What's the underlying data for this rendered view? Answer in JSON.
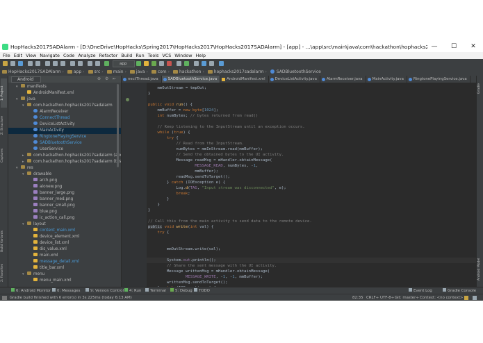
{
  "window": {
    "title": "HopHacks2017SADAlarm - [D:\\OneDrive\\HopHacks\\Spring2017\\HopHacks2017\\HopHacks2017SADAlarm] - [app] - ...\\app\\src\\main\\java\\com\\hackathon\\hophacks2017sadalarm\\SADBluetoothService.java - Android Studio 2.2.3",
    "minimize": "—",
    "maximize": "☐",
    "close": "✕"
  },
  "menu": [
    "File",
    "Edit",
    "View",
    "Navigate",
    "Code",
    "Analyze",
    "Refactor",
    "Build",
    "Run",
    "Tools",
    "VCS",
    "Window",
    "Help"
  ],
  "toolbar": {
    "run_config": "app"
  },
  "breadcrumbs": [
    "HopHacks2017SADAlarm",
    "app",
    "src",
    "main",
    "java",
    "com",
    "hackathon",
    "hophacks2017sadalarm",
    "SADBluetoothService"
  ],
  "left_tool_tabs": [
    "1: Project",
    "Z: Structure",
    "Captures",
    "Build Variants",
    "2: Favorites"
  ],
  "right_tool_tabs": [
    "Gradle",
    "Android Model"
  ],
  "project_view": {
    "mode": "Android"
  },
  "tree": [
    {
      "label": "manifests",
      "depth": 0,
      "icon": "folder",
      "arrow": "▾"
    },
    {
      "label": "AndroidManifest.xml",
      "depth": 1,
      "icon": "xml"
    },
    {
      "label": "java",
      "depth": 0,
      "icon": "folder",
      "arrow": "▾"
    },
    {
      "label": "com.hackathon.hophacks2017sadalarm",
      "depth": 1,
      "icon": "package",
      "arrow": "▾"
    },
    {
      "label": "AlarmReceiver",
      "depth": 2,
      "icon": "class"
    },
    {
      "label": "ConnectThread",
      "depth": 2,
      "icon": "class",
      "color": "#4a9bd8"
    },
    {
      "label": "DeviceListActivity",
      "depth": 2,
      "icon": "class"
    },
    {
      "label": "MainActivity",
      "depth": 2,
      "icon": "class",
      "selected": true
    },
    {
      "label": "RingtonePlayingService",
      "depth": 2,
      "icon": "class",
      "color": "#4a9bd8"
    },
    {
      "label": "SADBluetoothService",
      "depth": 2,
      "icon": "class",
      "color": "#4a9bd8"
    },
    {
      "label": "UserService",
      "depth": 2,
      "icon": "class"
    },
    {
      "label": "com.hackathon.hophacks2017sadalarm (androidTest)",
      "depth": 1,
      "icon": "package",
      "arrow": "▸"
    },
    {
      "label": "com.hackathon.hophacks2017sadalarm (test)",
      "depth": 1,
      "icon": "package",
      "arrow": "▸"
    },
    {
      "label": "res",
      "depth": 0,
      "icon": "folder",
      "arrow": "▾"
    },
    {
      "label": "drawable",
      "depth": 1,
      "icon": "folder",
      "arrow": "▾"
    },
    {
      "label": "arch.png",
      "depth": 2,
      "icon": "image"
    },
    {
      "label": "aionew.png",
      "depth": 2,
      "icon": "image"
    },
    {
      "label": "banner_large.png",
      "depth": 2,
      "icon": "image"
    },
    {
      "label": "banner_med.png",
      "depth": 2,
      "icon": "image"
    },
    {
      "label": "banner_small.png",
      "depth": 2,
      "icon": "image"
    },
    {
      "label": "blue.png",
      "depth": 2,
      "icon": "image"
    },
    {
      "label": "ic_action_call.png",
      "depth": 2,
      "icon": "image"
    },
    {
      "label": "layout",
      "depth": 1,
      "icon": "folder",
      "arrow": "▾"
    },
    {
      "label": "content_main.xml",
      "depth": 2,
      "icon": "xml",
      "color": "#4a9bd8"
    },
    {
      "label": "device_element.xml",
      "depth": 2,
      "icon": "xml"
    },
    {
      "label": "device_list.xml",
      "depth": 2,
      "icon": "xml"
    },
    {
      "label": "dis_value.xml",
      "depth": 2,
      "icon": "xml"
    },
    {
      "label": "main.xml",
      "depth": 2,
      "icon": "xml"
    },
    {
      "label": "message_detail.xml",
      "depth": 2,
      "icon": "xml",
      "color": "#4a9bd8"
    },
    {
      "label": "title_bar.xml",
      "depth": 2,
      "icon": "xml"
    },
    {
      "label": "menu",
      "depth": 1,
      "icon": "folder",
      "arrow": "▾"
    },
    {
      "label": "menu_main.xml",
      "depth": 2,
      "icon": "xml"
    }
  ],
  "editor_tabs": [
    {
      "label": "nectThread.java",
      "type": "java"
    },
    {
      "label": "SADBluetoothService.java",
      "type": "java",
      "active": true
    },
    {
      "label": "AndroidManifest.xml",
      "type": "xml"
    },
    {
      "label": "DeviceListActivity.java",
      "type": "java"
    },
    {
      "label": "AlarmReceiver.java",
      "type": "java"
    },
    {
      "label": "MainActivity.java",
      "type": "java"
    },
    {
      "label": "RingtonePlayingService.java",
      "type": "java"
    }
  ],
  "code_lines": [
    {
      "i": 0,
      "parts": [
        [
          "",
          "    mmOutStream = tmpOut;"
        ]
      ]
    },
    {
      "i": 1,
      "parts": [
        [
          "",
          "}"
        ]
      ]
    },
    {
      "i": 3,
      "parts": [
        [
          "kw",
          "public void "
        ],
        [
          "fn",
          "run"
        ],
        [
          "",
          "() {"
        ]
      ]
    },
    {
      "i": 4,
      "parts": [
        [
          "",
          "    mmBuffer = "
        ],
        [
          "kw",
          "new byte"
        ],
        [
          "",
          "["
        ],
        [
          "nm",
          "1024"
        ],
        [
          "",
          "];"
        ]
      ]
    },
    {
      "i": 5,
      "parts": [
        [
          "kw",
          "    int "
        ],
        [
          "",
          "numBytes; "
        ],
        [
          "cm",
          "// bytes returned from read()"
        ]
      ]
    },
    {
      "i": 7,
      "parts": [
        [
          "cm",
          "    // Keep listening to the InputStream until an exception occurs."
        ]
      ]
    },
    {
      "i": 8,
      "parts": [
        [
          "kw",
          "    while "
        ],
        [
          "",
          "("
        ],
        [
          "kw",
          "true"
        ],
        [
          "",
          ") {"
        ]
      ]
    },
    {
      "i": 9,
      "parts": [
        [
          "kw",
          "        try "
        ],
        [
          "",
          "{"
        ]
      ]
    },
    {
      "i": 10,
      "parts": [
        [
          "cm",
          "            // Read from the InputStream."
        ]
      ]
    },
    {
      "i": 11,
      "parts": [
        [
          "",
          "            numBytes = mmInStream.read(mmBuffer);"
        ]
      ]
    },
    {
      "i": 12,
      "parts": [
        [
          "cm",
          "            // Send the obtained bytes to the UI activity."
        ]
      ]
    },
    {
      "i": 13,
      "parts": [
        [
          "",
          "            Message readMsg = mHandler.obtainMessage("
        ]
      ]
    },
    {
      "i": 14,
      "parts": [
        [
          "pu",
          "                    MESSAGE_READ"
        ],
        [
          "",
          ", numBytes, -"
        ],
        [
          "nm",
          "1"
        ],
        [
          "",
          ","
        ]
      ]
    },
    {
      "i": 15,
      "parts": [
        [
          "",
          "                    mmBuffer);"
        ]
      ]
    },
    {
      "i": 16,
      "parts": [
        [
          "",
          "            readMsg.sendToTarget();"
        ]
      ]
    },
    {
      "i": 17,
      "parts": [
        [
          "",
          "        } "
        ],
        [
          "kw",
          "catch "
        ],
        [
          "",
          "(IOException e) {"
        ]
      ]
    },
    {
      "i": 18,
      "parts": [
        [
          "",
          "            Log."
        ],
        [
          "fn",
          "d"
        ],
        [
          "",
          "("
        ],
        [
          "pu",
          "TAG"
        ],
        [
          "",
          ", "
        ],
        [
          "st",
          "\"Input stream was disconnected\""
        ],
        [
          "",
          ", e);"
        ]
      ]
    },
    {
      "i": 19,
      "parts": [
        [
          "kw",
          "            break"
        ],
        [
          "",
          ";"
        ]
      ]
    },
    {
      "i": 20,
      "parts": [
        [
          "",
          "        }"
        ]
      ]
    },
    {
      "i": 21,
      "parts": [
        [
          "",
          "    }"
        ]
      ]
    },
    {
      "i": 22,
      "parts": [
        [
          "",
          "}"
        ]
      ]
    },
    {
      "i": 24,
      "parts": [
        [
          "cm",
          "// Call this from the main activity to send data to the remote device."
        ]
      ]
    },
    {
      "i": 25,
      "parts": [
        [
          "hl",
          "public"
        ],
        [
          "kw",
          " void "
        ],
        [
          "fn",
          "write"
        ],
        [
          "",
          "("
        ],
        [
          "kw",
          "int "
        ],
        [
          "",
          "val) {"
        ]
      ]
    },
    {
      "i": 26,
      "parts": [
        [
          "kw",
          "    try "
        ],
        [
          "",
          "{"
        ]
      ]
    },
    {
      "i": 29,
      "parts": [
        [
          "",
          "        mmOutStream.write(val);"
        ]
      ]
    },
    {
      "i": 31,
      "parts": [
        [
          "",
          "        System."
        ],
        [
          "pu",
          "out"
        ],
        [
          "",
          ".println();"
        ]
      ]
    },
    {
      "i": 32,
      "parts": [
        [
          "cm",
          "        // Share the sent message with the UI activity."
        ]
      ]
    },
    {
      "i": 33,
      "parts": [
        [
          "",
          "        Message writtenMsg = mHandler.obtainMessage("
        ]
      ]
    },
    {
      "i": 34,
      "parts": [
        [
          "pu",
          "                MESSAGE_WRITE"
        ],
        [
          "",
          ", -"
        ],
        [
          "nm",
          "1"
        ],
        [
          "",
          ", -"
        ],
        [
          "nm",
          "1"
        ],
        [
          "",
          ", mmBuffer);"
        ]
      ]
    },
    {
      "i": 35,
      "parts": [
        [
          "",
          "        writtenMsg.sendToTarget();"
        ]
      ]
    },
    {
      "i": 36,
      "parts": [
        [
          "",
          "    } "
        ],
        [
          "kw",
          "catch "
        ],
        [
          "",
          "(IOException e) {"
        ]
      ]
    }
  ],
  "bottom_tabs": {
    "left": [
      "6: Android Monitor",
      "0: Messages",
      "9: Version Control",
      "4: Run",
      "Terminal",
      "5: Debug",
      "TODO"
    ],
    "right": [
      "Event Log",
      "Gradle Console"
    ]
  },
  "status": {
    "message": "Gradle build finished with 6 error(s) in 3s 225ms (today 6:13 AM)",
    "position": "82:35",
    "line_sep": "CRLF÷",
    "encoding": "UTF-8÷",
    "git": "Git: master÷",
    "context": "Context: <no context>"
  }
}
